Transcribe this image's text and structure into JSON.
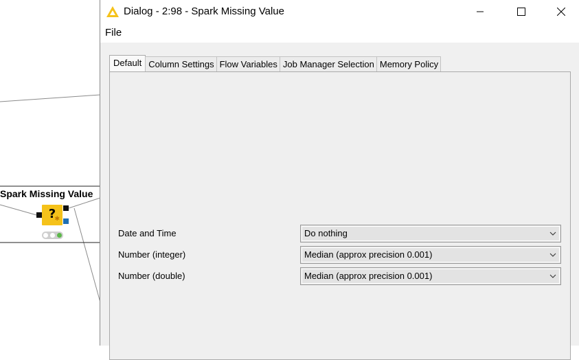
{
  "window": {
    "title": "Dialog - 2:98 - Spark Missing Value"
  },
  "menu": {
    "file": "File"
  },
  "tabs": [
    {
      "label": "Default",
      "active": true
    },
    {
      "label": "Column Settings",
      "active": false
    },
    {
      "label": "Flow Variables",
      "active": false
    },
    {
      "label": "Job Manager Selection",
      "active": false
    },
    {
      "label": "Memory Policy",
      "active": false
    }
  ],
  "settings": [
    {
      "label": "Date and Time",
      "value": "Do nothing"
    },
    {
      "label": "Number (integer)",
      "value": "Median (approx precision 0.001)"
    },
    {
      "label": "Number (double)",
      "value": "Median (approx precision 0.001)"
    }
  ],
  "workflow": {
    "node_title": "Spark Missing Value",
    "node_glyph": "?",
    "canvas_mark": ":"
  },
  "colors": {
    "node_yellow": "#f5c21a",
    "port_blue": "#1f6fb4",
    "status_green": "#5cb84a",
    "dialog_bg": "#f0f0f0"
  }
}
